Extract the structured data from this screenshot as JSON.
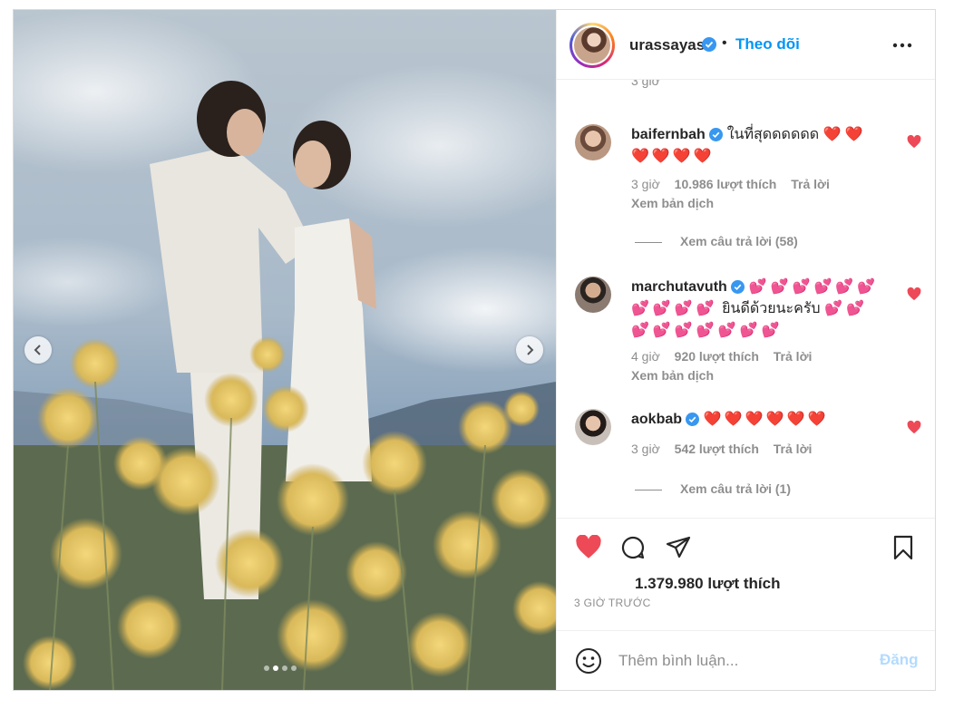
{
  "header": {
    "username": "urassayas",
    "separator": "•",
    "follow_label": "Theo dõi",
    "avatar_icon": "profile-avatar",
    "more_icon": "more-options-icon"
  },
  "carousel": {
    "slide_count": 4,
    "active_slide": 2,
    "prev_icon": "chevron-left-icon",
    "next_icon": "chevron-right-icon"
  },
  "comments": {
    "previous_time": "3 giờ",
    "items": [
      {
        "username": "baifernbah",
        "line1": "ในที่สุดดดดดด ❤️ ❤️",
        "line2": "❤️❤️❤️❤️",
        "time": "3 giờ",
        "likes": "10.986 lượt thích",
        "reply_label": "Trả lời",
        "translate_label": "Xem bản dịch",
        "replies_label": "Xem câu trả lời (58)"
      },
      {
        "username": "marchutavuth",
        "line1": "💕💕💕💕💕💕",
        "line2_pre": "💕💕💕💕",
        "line2_text": "ยินดีด้วยนะครับ",
        "line2_post": "💕💕",
        "line3": "💕💕💕💕💕💕💕",
        "time": "4 giờ",
        "likes": "920 lượt thích",
        "reply_label": "Trả lời",
        "translate_label": "Xem bản dịch"
      },
      {
        "username": "aokbab",
        "line1": "❤️❤️❤️❤️❤️❤️",
        "time": "3 giờ",
        "likes": "542 lượt thích",
        "reply_label": "Trả lời",
        "replies_label": "Xem câu trả lời (1)"
      }
    ]
  },
  "actions": {
    "like_icon": "heart-filled-icon",
    "comment_icon": "comment-icon",
    "share_icon": "send-icon",
    "save_icon": "bookmark-icon",
    "likes_total": "1.379.980 lượt thích",
    "posted": "3 GIỜ TRƯỚC"
  },
  "composer": {
    "emoji_icon": "emoji-icon",
    "placeholder": "Thêm bình luận...",
    "post_label": "Đăng"
  },
  "colors": {
    "accent_blue": "#0095f6",
    "like_red": "#ed4956",
    "muted_text": "#8e8e8e",
    "post_disabled": "#b3dbff"
  }
}
